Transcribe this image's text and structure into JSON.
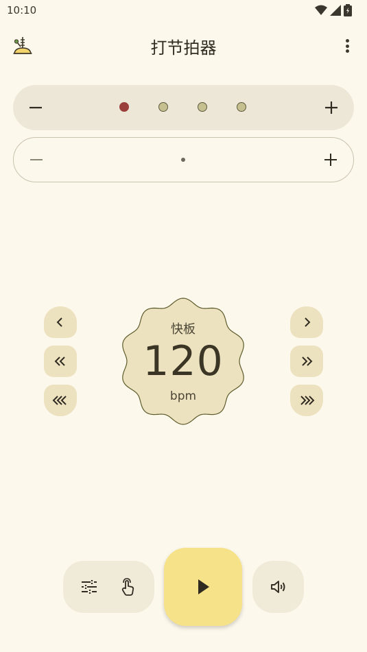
{
  "status": {
    "time": "10:10"
  },
  "header": {
    "title": "打节拍器"
  },
  "beats": {
    "count": 4,
    "accent_index": 0
  },
  "tempo": {
    "name": "快板",
    "value": "120",
    "unit": "bpm"
  },
  "colors": {
    "background": "#fdf8ec",
    "accent_beat": "#9b3f3a",
    "normal_beat": "#c6bf8f",
    "dial": "#ede2bf",
    "play_button": "#f6e289"
  },
  "icons": {
    "app": "metronome-icon",
    "more": "more-vert-icon",
    "settings": "tune-icon",
    "tap": "tap-icon",
    "play": "play-icon",
    "sound": "volume-icon"
  }
}
